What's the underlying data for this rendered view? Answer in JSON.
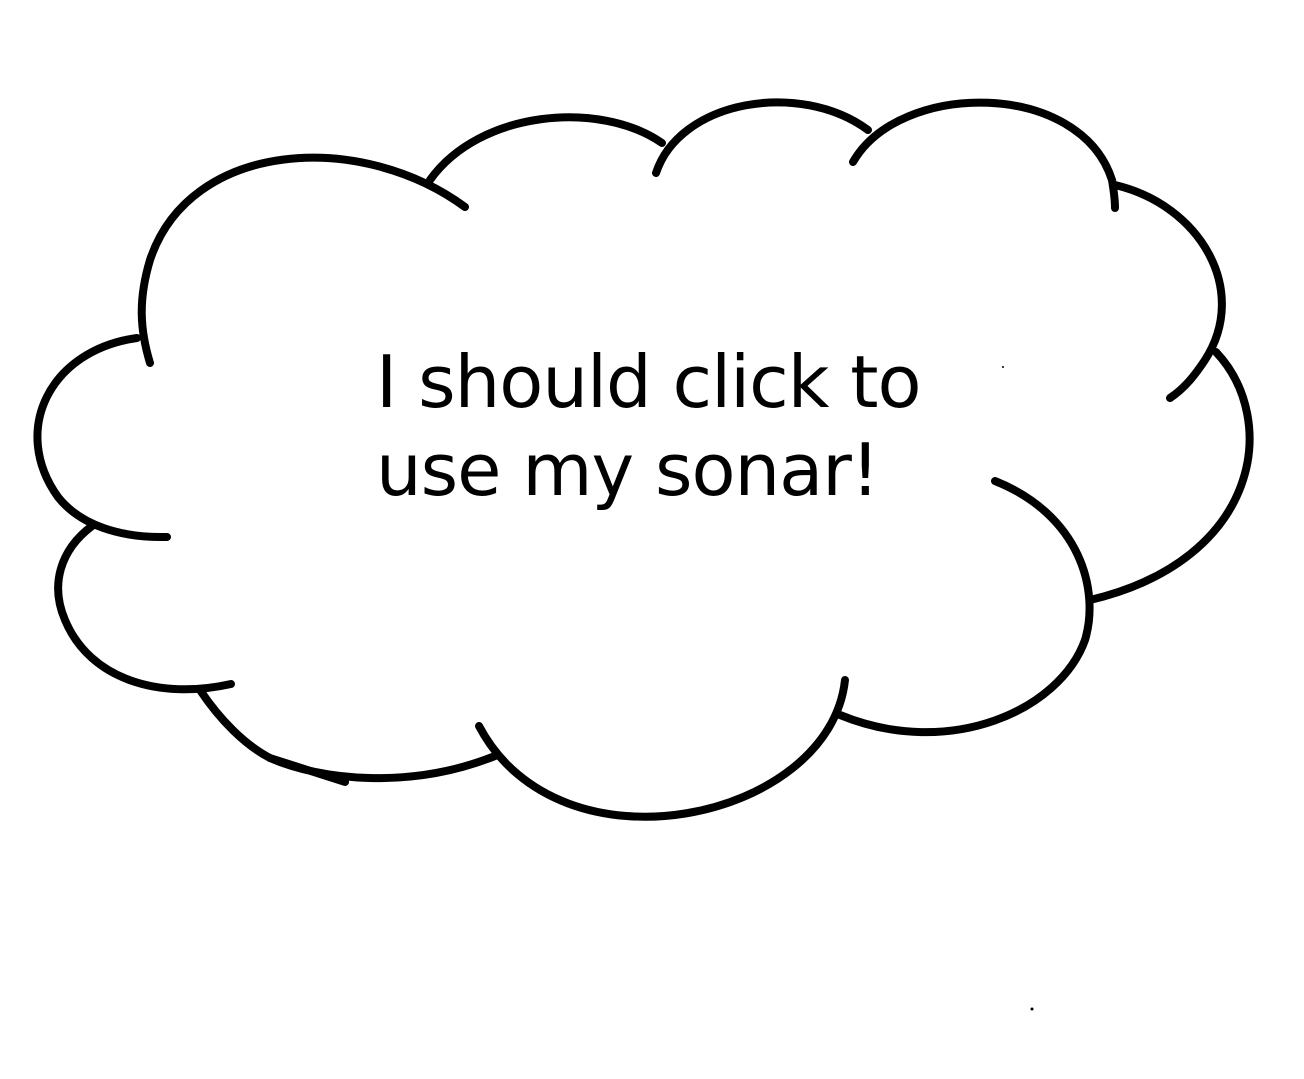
{
  "thought_bubble": {
    "lines": [
      "I should click to",
      "use my sonar!"
    ],
    "stroke_color": "#000000",
    "fill_color": "#ffffff"
  }
}
